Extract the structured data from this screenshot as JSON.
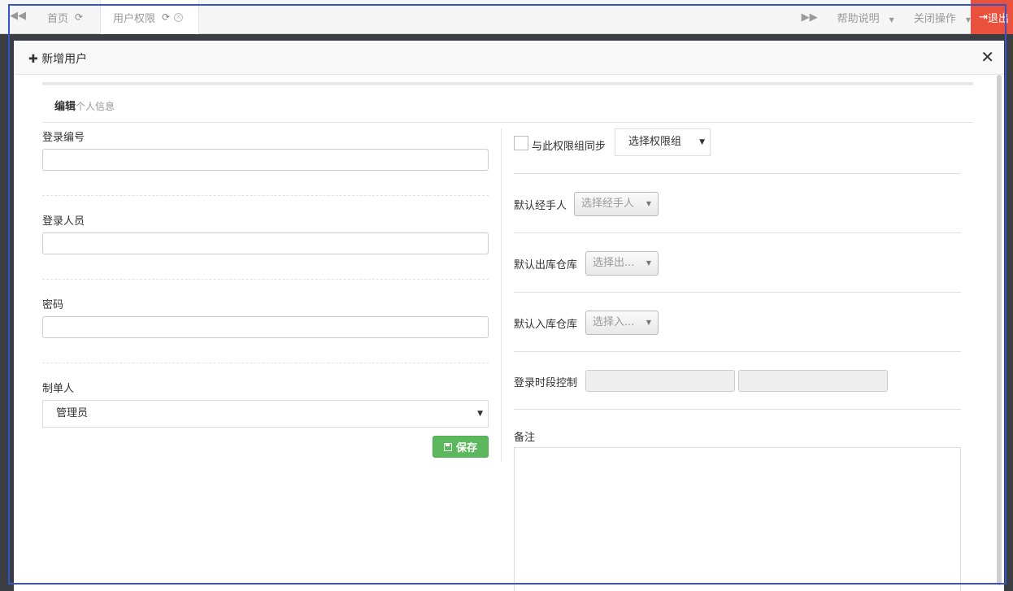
{
  "tabbar": {
    "home_tab": "首页",
    "active_tab": "用户权限",
    "help": "帮助说明",
    "close_ops": "关闭操作",
    "logout": "退出"
  },
  "modal": {
    "title": "新增用户",
    "section_title": "编辑",
    "section_subtitle": "个人信息",
    "save_label": "保存"
  },
  "left_form": {
    "login_no_label": "登录编号",
    "login_no_value": "",
    "login_user_label": "登录人员",
    "login_user_value": "",
    "password_label": "密码",
    "password_value": "",
    "creator_label": "制单人",
    "creator_value": "管理员"
  },
  "right_form": {
    "sync_label": "与此权限组同步",
    "perm_group_placeholder": "选择权限组",
    "default_handler_label": "默认经手人",
    "default_handler_placeholder": "选择经手人",
    "default_out_wh_label": "默认出库仓库",
    "default_out_wh_placeholder": "选择出...",
    "default_in_wh_label": "默认入库仓库",
    "default_in_wh_placeholder": "选择入...",
    "login_time_label": "登录时段控制",
    "remarks_label": "备注"
  },
  "colors": {
    "logout_bg": "#e9513c",
    "save_bg": "#5cb85c",
    "frame": "#3753c9"
  }
}
